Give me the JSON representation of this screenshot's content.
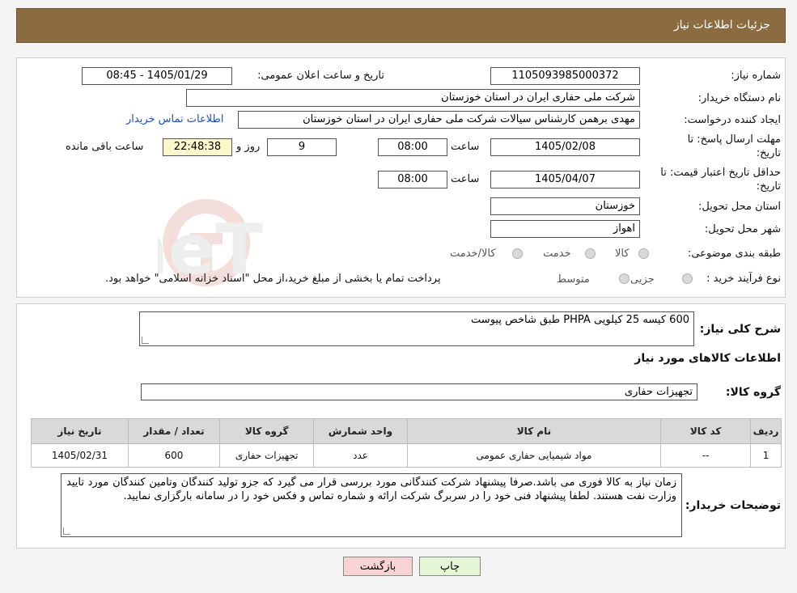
{
  "header": {
    "title": "جزئیات اطلاعات نیاز"
  },
  "form": {
    "need_number_label": "شماره نیاز:",
    "need_number": "1105093985000372",
    "announce_label": "تاریخ و ساعت اعلان عمومی:",
    "announce_value": "1405/01/29 - 08:45",
    "buyer_org_label": "نام دستگاه خریدار:",
    "buyer_org": "شرکت ملی حفاری ایران در استان خوزستان",
    "requester_label": "ایجاد کننده درخواست:",
    "requester": "مهدی برهمن کارشناس سیالات شرکت ملی حفاری ایران در استان خوزستان",
    "contact_link": "اطلاعات تماس خریدار",
    "deadline_label_line1": "مهلت ارسال پاسخ: تا",
    "deadline_label_line2": "تاریخ:",
    "deadline_date": "1405/02/08",
    "time_label": "ساعت",
    "deadline_time": "08:00",
    "days_value": "9",
    "days_suffix": "روز و",
    "remaining_time": "22:48:38",
    "remaining_suffix": "ساعت باقی مانده",
    "validity_label_line1": "حداقل تاریخ اعتبار قیمت: تا",
    "validity_label_line2": "تاریخ:",
    "validity_date": "1405/04/07",
    "validity_time": "08:00",
    "province_label": "استان محل تحویل:",
    "province": "خوزستان",
    "city_label": "شهر محل تحویل:",
    "city": "اهواز",
    "category_label": "طبقه بندی موضوعی:",
    "category_options": [
      "کالا",
      "خدمت",
      "کالا/خدمت"
    ],
    "purchase_type_label": "نوع فرآیند خرید :",
    "purchase_options": [
      "جزیی",
      "متوسط"
    ],
    "purchase_note": "پرداخت تمام یا بخشی از مبلغ خرید،از محل \"اسناد خزانه اسلامی\" خواهد بود."
  },
  "details": {
    "summary_label": "شرح کلی نیاز:",
    "summary": "600 کیسه 25 کیلویی PHPA  طبق شاخص پیوست",
    "goods_info_title": "اطلاعات کالاهای مورد نیاز",
    "goods_group_label": "گروه کالا:",
    "goods_group": "تجهیزات حفاری",
    "table": {
      "headers": [
        "ردیف",
        "کد کالا",
        "نام کالا",
        "واحد شمارش",
        "گروه کالا",
        "تعداد / مقدار",
        "تاریخ نیاز"
      ],
      "rows": [
        [
          "1",
          "--",
          "مواد شیمیایی حفاری عمومی",
          "عدد",
          "تجهیزات حفاری",
          "600",
          "1405/02/31"
        ]
      ]
    },
    "buyer_notes_label": "توضیحات خریدار:",
    "buyer_notes": "زمان نیاز به کالا فوری می باشد.صرفا پیشنهاد شرکت کنندگانی مورد بررسی قرار می گیرد که جزو تولید کنندگان وتامین کنندگان مورد تایید وزارت نفت هستند. لطفا پیشنهاد فنی خود را در سربرگ شرکت ارائه و شماره تماس و فکس خود را در سامانه بارگزاری نمایید."
  },
  "buttons": {
    "print": "چاپ",
    "back": "بازگشت"
  },
  "colors": {
    "header_bg": "#8b6b40",
    "link": "#1a4fbf",
    "back_button_bg": "#f7d3d3",
    "print_button_bg": "#e6f7d8"
  }
}
